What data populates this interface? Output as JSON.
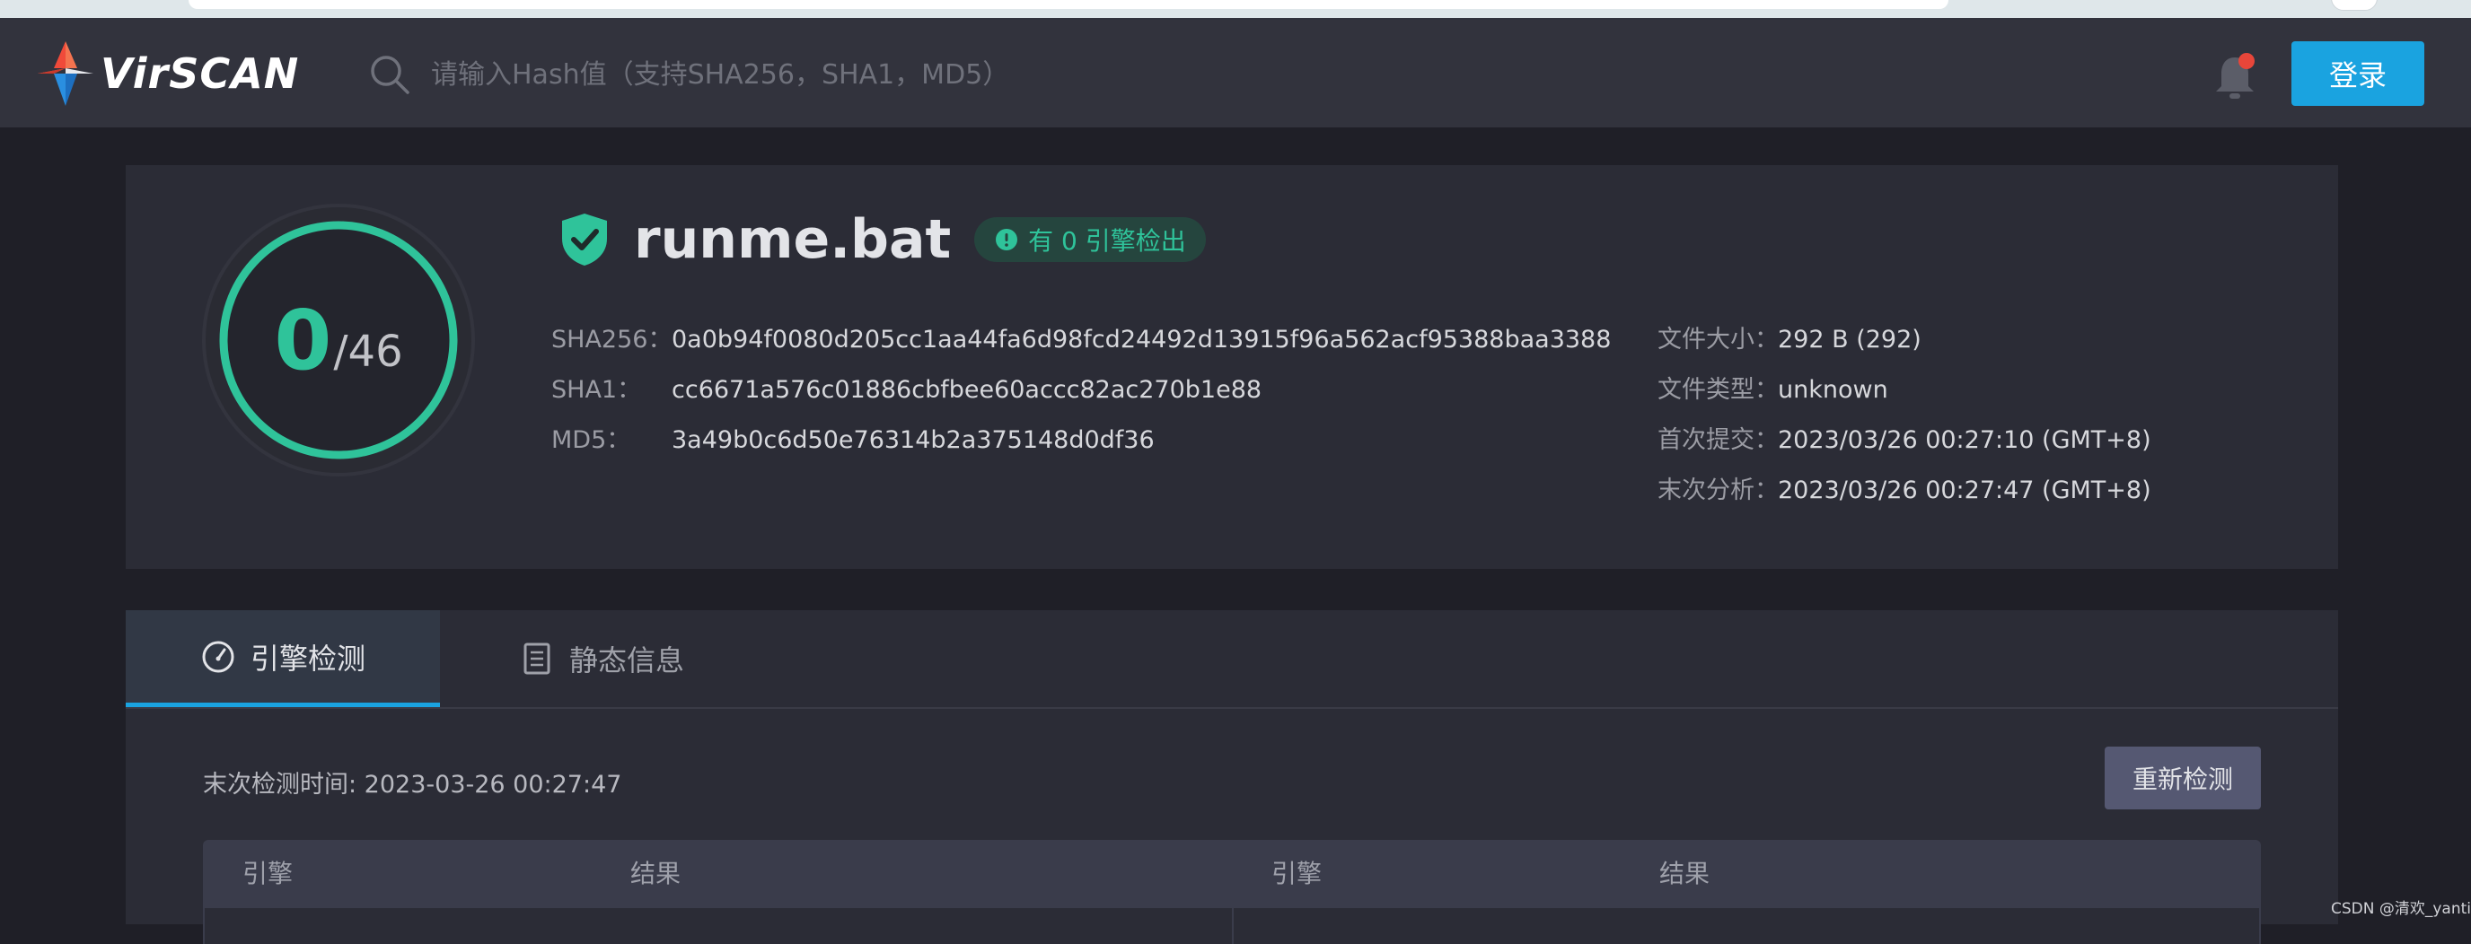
{
  "brand": {
    "name": "VirSCAN"
  },
  "search": {
    "placeholder": "请输入Hash值（支持SHA256，SHA1，MD5）"
  },
  "header": {
    "login_label": "登录"
  },
  "summary": {
    "score": "0",
    "score_total": "/46",
    "file_name": "runme.bat",
    "badge_text": "有 0 引擎检出",
    "hashes": [
      {
        "label": "SHA256：",
        "value": "0a0b94f0080d205cc1aa44fa6d98fcd24492d13915f96a562acf95388baa3388"
      },
      {
        "label": "SHA1：",
        "value": "cc6671a576c01886cbfbee60accc82ac270b1e88"
      },
      {
        "label": "MD5：",
        "value": "3a49b0c6d50e76314b2a375148d0df36"
      }
    ],
    "info": [
      {
        "label": "文件大小：",
        "value": "292 B (292)"
      },
      {
        "label": "文件类型：",
        "value": "unknown"
      },
      {
        "label": "首次提交：",
        "value": "2023/03/26 00:27:10 (GMT+8)"
      },
      {
        "label": "末次分析：",
        "value": "2023/03/26 00:27:47 (GMT+8)"
      }
    ]
  },
  "tabs": [
    {
      "label": "引擎检测",
      "icon": "gauge-icon",
      "active": true
    },
    {
      "label": "静态信息",
      "icon": "document-list-icon",
      "active": false
    }
  ],
  "engine_panel": {
    "last_scan": "末次检测时间: 2023-03-26 00:27:47",
    "rescan_label": "重新检测",
    "columns": [
      "引擎",
      "结果",
      "引擎",
      "结果"
    ]
  },
  "watermark": "CSDN @清欢_yanti",
  "colors": {
    "accent": "#1aa3e0",
    "safe": "#2fc39a",
    "notification": "#e8463a"
  }
}
